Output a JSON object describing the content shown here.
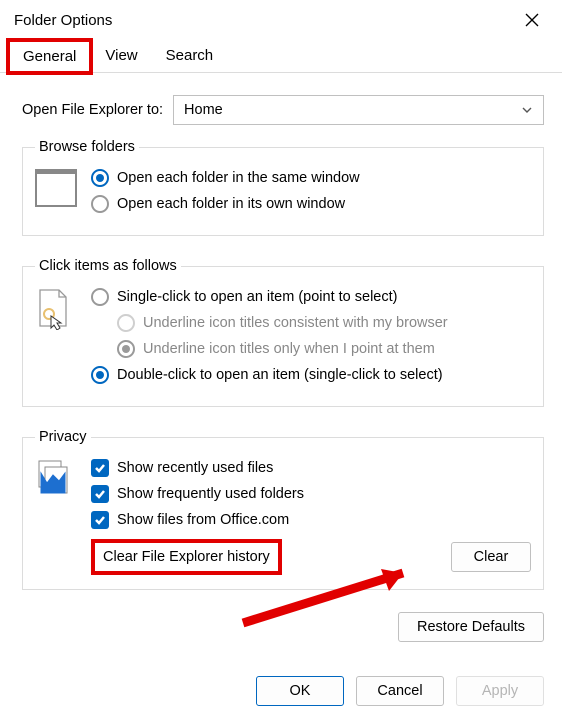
{
  "title": "Folder Options",
  "tabs": {
    "general": "General",
    "view": "View",
    "search": "Search"
  },
  "openExplorer": {
    "label": "Open File Explorer to:",
    "value": "Home"
  },
  "browse": {
    "legend": "Browse folders",
    "same": "Open each folder in the same window",
    "own": "Open each folder in its own window"
  },
  "click": {
    "legend": "Click items as follows",
    "single": "Single-click to open an item (point to select)",
    "ul_browser": "Underline icon titles consistent with my browser",
    "ul_point": "Underline icon titles only when I point at them",
    "double": "Double-click to open an item (single-click to select)"
  },
  "privacy": {
    "legend": "Privacy",
    "recent": "Show recently used files",
    "frequent": "Show frequently used folders",
    "office": "Show files from Office.com",
    "clear_label": "Clear File Explorer history",
    "clear_btn": "Clear"
  },
  "restore": "Restore Defaults",
  "buttons": {
    "ok": "OK",
    "cancel": "Cancel",
    "apply": "Apply"
  }
}
